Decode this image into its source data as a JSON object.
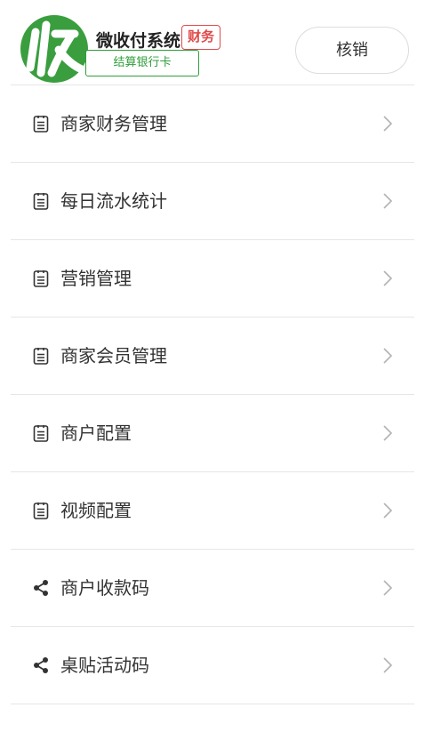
{
  "header": {
    "app_name": "微收付系统",
    "role_badge": "财务",
    "bank_tag": "结算银行卡",
    "verify_button": "核销",
    "logo_colors": {
      "circle": "#3a9e3f",
      "glyph": "#ffffff"
    }
  },
  "menu": {
    "items": [
      {
        "label": "商家财务管理",
        "icon": "document-icon"
      },
      {
        "label": "每日流水统计",
        "icon": "document-icon"
      },
      {
        "label": "营销管理",
        "icon": "document-icon"
      },
      {
        "label": "商家会员管理",
        "icon": "document-icon"
      },
      {
        "label": "商户配置",
        "icon": "document-icon"
      },
      {
        "label": "视频配置",
        "icon": "document-icon"
      },
      {
        "label": "商户收款码",
        "icon": "share-icon"
      },
      {
        "label": "桌贴活动码",
        "icon": "share-icon"
      }
    ]
  },
  "colors": {
    "badge_red": "#e04a4a",
    "tag_green": "#2e9e3a",
    "divider": "#e6e6e6",
    "chevron": "#b3b3b3"
  }
}
